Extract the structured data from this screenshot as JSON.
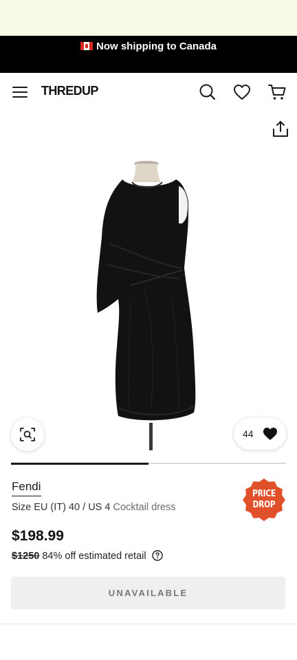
{
  "banner": {
    "flag_icon": "canada-flag-icon",
    "text": "Now shipping to Canada"
  },
  "header": {
    "logo": "THREDUP",
    "menu_icon": "hamburger-menu-icon",
    "search_icon": "search-icon",
    "favorites_icon": "heart-outline-icon",
    "cart_icon": "shopping-cart-icon"
  },
  "gallery": {
    "share_icon": "share-icon",
    "image_alt": "Black one-shoulder draped dress on mannequin",
    "zoom_icon": "visual-search-icon",
    "favorite_count": "44",
    "favorite_icon": "heart-filled-icon",
    "image_progress": 0.5
  },
  "product": {
    "brand": "Fendi",
    "size_text": "Size EU (IT) 40 / US 4",
    "category": "Cocktail dress",
    "badge_line1": "PRICE",
    "badge_line2": "DROP",
    "price": "$198.99",
    "retail_price": "$1250",
    "discount_text": "84% off estimated retail",
    "help_icon": "question-circle-icon",
    "cta_label": "UNAVAILABLE"
  },
  "colors": {
    "top_strip": "#f7fbe6",
    "banner_bg": "#000000",
    "badge": "#e0502a",
    "cta_bg": "#efefef"
  }
}
